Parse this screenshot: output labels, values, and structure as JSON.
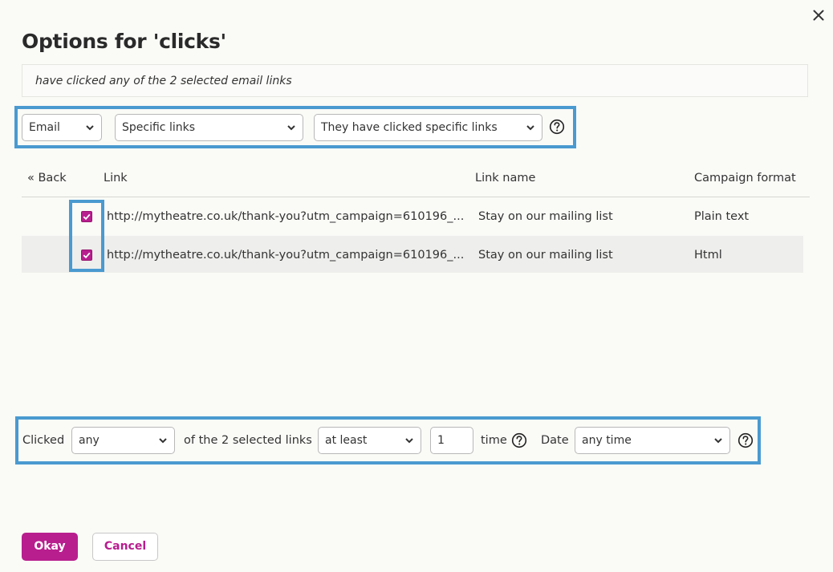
{
  "dialog": {
    "title": "Options for 'clicks'",
    "summary": "have clicked any of the 2 selected email links"
  },
  "filters": {
    "channel": "Email",
    "scope": "Specific links",
    "condition": "They have clicked specific links"
  },
  "table": {
    "back_label": "« Back",
    "headers": {
      "link": "Link",
      "link_name": "Link name",
      "campaign_format": "Campaign format"
    },
    "rows": [
      {
        "checked": true,
        "link": "http://mytheatre.co.uk/thank-you?utm_campaign=610196_...",
        "link_name": "Stay on our mailing list",
        "campaign_format": "Plain text"
      },
      {
        "checked": true,
        "link": "http://mytheatre.co.uk/thank-you?utm_campaign=610196_...",
        "link_name": "Stay on our mailing list",
        "campaign_format": "Html"
      }
    ]
  },
  "criteria": {
    "clicked_label": "Clicked",
    "quantifier": "any",
    "selected_links_label": "of the 2 selected links",
    "comparison": "at least",
    "count": "1",
    "time_label": "time",
    "date_label": "Date",
    "date_range": "any time"
  },
  "buttons": {
    "okay": "Okay",
    "cancel": "Cancel"
  },
  "colors": {
    "accent": "#b81e8e",
    "highlight": "#4a9ad0"
  }
}
